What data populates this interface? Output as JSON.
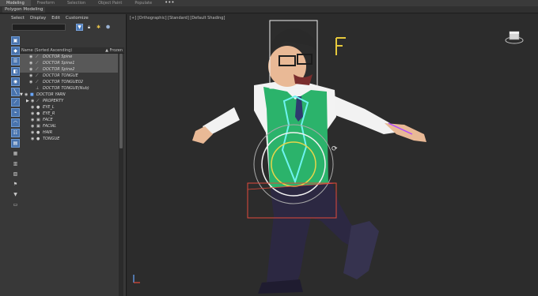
{
  "ribbon": {
    "tabs": [
      "Modeling",
      "Freeform",
      "Selection",
      "Object Paint",
      "Populate"
    ],
    "more": "•••",
    "active_tab": "Modeling"
  },
  "ribbon_sub": {
    "label": "Polygon Modeling"
  },
  "scene_explorer": {
    "menu": [
      "Select",
      "Display",
      "Edit",
      "Customize"
    ],
    "search_value": "",
    "filters": [
      "filter-icon",
      "lock-icon",
      "light-icon",
      "teapot-icon"
    ],
    "column_name": "Name (Sorted Ascending)",
    "column_frozen": "▲ Frozen",
    "rows": [
      {
        "label": "DOCTOR Spine",
        "icon": "bone-icon",
        "indent": 2,
        "selected": true
      },
      {
        "label": "DOCTOR Spine1",
        "icon": "bone-icon",
        "indent": 2,
        "selected": true
      },
      {
        "label": "DOCTOR Spine2",
        "icon": "bone-icon",
        "indent": 2,
        "selected": true
      },
      {
        "label": "DOCTOR TONGUE",
        "icon": "bone-icon",
        "indent": 2,
        "selected": false
      },
      {
        "label": "DOCTOR TONGUE02",
        "icon": "bone-icon",
        "indent": 2,
        "selected": false
      },
      {
        "label": "DOCTOR TONGUE(Nub)",
        "icon": "bone-nub-icon",
        "indent": 2,
        "selected": false
      },
      {
        "label": "DOCTOR YARN",
        "icon": "object-icon",
        "indent": 0,
        "selected": false,
        "expanded": true
      },
      {
        "label": "PROPERTY",
        "icon": "bone-icon",
        "indent": 1,
        "selected": false,
        "collapsed": true
      },
      {
        "label": "EYE_L",
        "icon": "sphere-icon",
        "indent": 1,
        "selected": false
      },
      {
        "label": "EYE_R",
        "icon": "sphere-icon",
        "indent": 1,
        "selected": false
      },
      {
        "label": "FACE",
        "icon": "mesh-icon",
        "indent": 1,
        "selected": false
      },
      {
        "label": "FACIAL",
        "icon": "mesh-icon",
        "indent": 1,
        "selected": false
      },
      {
        "label": "HAIR",
        "icon": "sphere-icon",
        "indent": 1,
        "selected": false
      },
      {
        "label": "TONGUE",
        "icon": "sphere-icon",
        "indent": 1,
        "selected": false
      }
    ],
    "side_tools": [
      "select-icon",
      "display-icon",
      "hierarchy-icon",
      "modify-icon",
      "motion-icon",
      "utilities-icon",
      "bone-tool-icon",
      "link-icon",
      "sphere-tool-icon",
      "list-icon",
      "layers-icon",
      "filter-tool-icon",
      "doc-icon",
      "funnel-icon",
      "rectangle-icon"
    ]
  },
  "viewport": {
    "label": "[+] [Orthographic] [Standard] [Default Shading]",
    "viewcube": "viewcube-icon",
    "rotate_cursor": "rotate-cursor-icon"
  },
  "colors": {
    "accent": "#4a78b6",
    "viewport_bg": "#2c2c2c",
    "vest": "#2bb36b",
    "trousers": "#2c2842",
    "skin": "#e9b996",
    "selection": "#ffffff"
  }
}
